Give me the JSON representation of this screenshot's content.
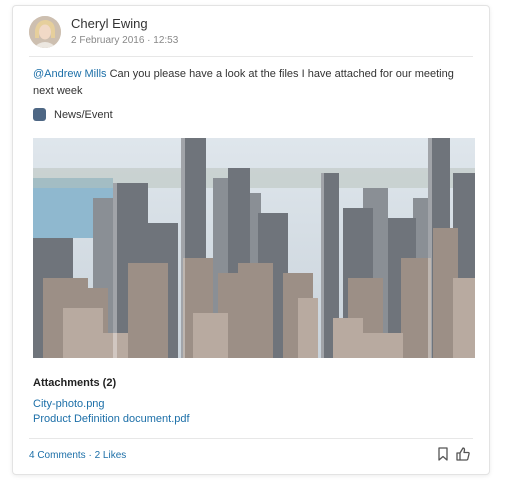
{
  "post": {
    "author": "Cheryl Ewing",
    "date": "2 February 2016 · 12:53",
    "mention": "@Andrew Mills",
    "message_body": " Can you please have a look at the files I have attached for our meeting next week",
    "category": "News/Event",
    "category_color": "#4e6784",
    "image_alt": "city skyline photo"
  },
  "attachments": {
    "title": "Attachments (2)",
    "files": [
      "City-photo.png",
      "Product Definition document.pdf"
    ]
  },
  "footer": {
    "stats": "4 Comments · 2 Likes",
    "actions": [
      {
        "name": "bookmark-icon"
      },
      {
        "name": "thumbs-up-icon"
      }
    ]
  },
  "colors": {
    "link": "#1c6fa8",
    "muted": "#888888",
    "border": "#e3e3e3"
  }
}
